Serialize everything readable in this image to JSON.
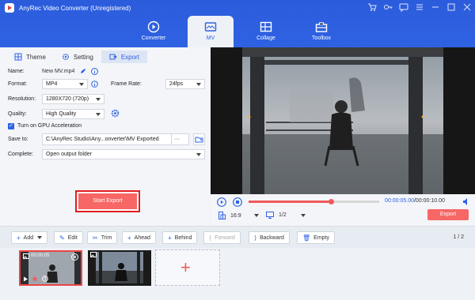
{
  "app": {
    "title": "AnyRec Video Converter (Unregistered)"
  },
  "window_icons": [
    "cart-icon",
    "key-icon",
    "chat-icon",
    "menu-icon",
    "minimize-icon",
    "maximize-icon",
    "close-icon"
  ],
  "nav": {
    "tabs": [
      {
        "label": "Converter",
        "icon": "converter-icon"
      },
      {
        "label": "MV",
        "icon": "mv-icon",
        "active": true
      },
      {
        "label": "Collage",
        "icon": "collage-icon"
      },
      {
        "label": "Toolbox",
        "icon": "toolbox-icon"
      }
    ]
  },
  "subtabs": [
    {
      "label": "Theme",
      "icon": "theme-icon"
    },
    {
      "label": "Setting",
      "icon": "gear-icon"
    },
    {
      "label": "Export",
      "icon": "export-icon",
      "active": true
    }
  ],
  "export": {
    "name_label": "Name:",
    "name_value": "New MV.mp4",
    "format_label": "Format:",
    "format_value": "MP4",
    "frame_rate_label": "Frame Rate:",
    "frame_rate_value": "24fps",
    "resolution_label": "Resolution:",
    "resolution_value": "1280X720 (720p)",
    "quality_label": "Quality:",
    "quality_value": "High Quality",
    "gpu_label": "Turn on GPU Acceleration",
    "gpu_checked": true,
    "save_to_label": "Save to:",
    "save_to_value": "C:\\AnyRec Studio\\Any...onverter\\MV Exported",
    "save_to_more": "···",
    "complete_label": "Complete:",
    "complete_value": "Open output folder",
    "start_export_label": "Start Export"
  },
  "player": {
    "current_time": "00:00:05.00",
    "total_time": "/00:00:10.00",
    "progress": 0.63,
    "aspect_ratio": "16:9",
    "screen_ratio": "1/2",
    "export_label": "Export"
  },
  "toolbar": {
    "buttons": [
      {
        "label": "Add",
        "icon": "plus-icon"
      },
      {
        "label": "Edit",
        "icon": "edit-icon"
      },
      {
        "label": "Trim",
        "icon": "scissors-icon"
      },
      {
        "label": "Ahead",
        "icon": "ahead-icon"
      },
      {
        "label": "Behind",
        "icon": "behind-icon"
      },
      {
        "label": "Forward",
        "icon": "forward-icon",
        "disabled": true
      },
      {
        "label": "Backward",
        "icon": "backward-icon"
      },
      {
        "label": "Empty",
        "icon": "trash-icon"
      }
    ],
    "page_current": "1",
    "page_total": "2"
  },
  "timeline": {
    "clips": [
      {
        "duration": "00:00:05",
        "active": true
      },
      {
        "duration": "",
        "active": false
      }
    ],
    "add_label": "+"
  },
  "colors": {
    "brand_blue": "#2f62e3",
    "accent_red": "#f66766",
    "highlight_red": "#e11d1d"
  }
}
